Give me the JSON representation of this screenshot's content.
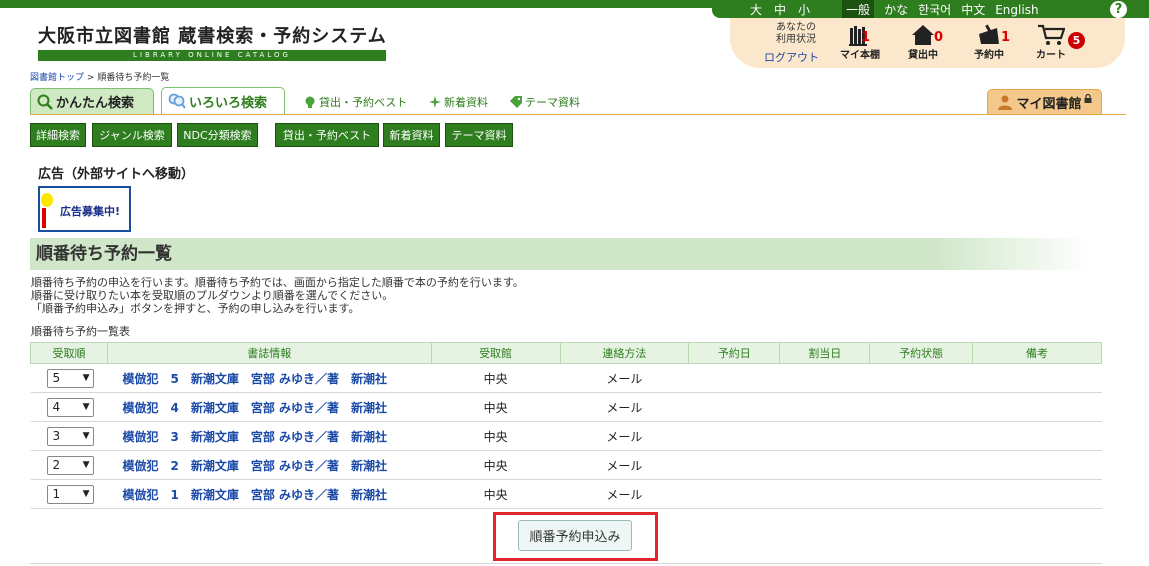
{
  "lang_bar": {
    "sizes": [
      "大",
      "中",
      "小"
    ],
    "general": "一般",
    "languages": [
      "かな",
      "한국어",
      "中文",
      "English"
    ],
    "help": "?"
  },
  "logo": {
    "title": "大阪市立図書館 蔵書検索・予約システム",
    "subtitle": "LIBRARY ONLINE CATALOG"
  },
  "user_panel": {
    "status_line1": "あなたの",
    "status_line2": "利用状況",
    "logout": "ログアウト",
    "my_shelf_label": "マイ本棚",
    "my_shelf_count": "1",
    "lending_label": "貸出中",
    "lending_count": "0",
    "reserved_label": "予約中",
    "reserved_count": "1",
    "cart_label": "カート",
    "cart_count": "5"
  },
  "breadcrumb": {
    "home": "図書館トップ",
    "sep": ">",
    "current": "順番待ち予約一覧"
  },
  "tabs": {
    "kantan": "かんたん検索",
    "iroiro": "いろいろ検索",
    "best": "貸出・予約ベスト",
    "new": "新着資料",
    "theme": "テーマ資料",
    "mylib": "マイ図書館"
  },
  "subnav": [
    "詳細検索",
    "ジャンル検索",
    "NDC分類検索",
    "貸出・予約ベスト",
    "新着資料",
    "テーマ資料"
  ],
  "ad": {
    "title": "広告（外部サイトへ移動）",
    "banner_text": "広告募集中!"
  },
  "page": {
    "title": "順番待ち予約一覧",
    "desc1": "順番待ち予約の申込を行います。順番待ち予約では、画面から指定した順番で本の予約を行います。",
    "desc2": "順番に受け取りたい本を受取順のプルダウンより順番を選んでください。",
    "desc3": "「順番予約申込み」ボタンを押すと、予約の申し込みを行います。",
    "caption": "順番待ち予約一覧表"
  },
  "table": {
    "headers": [
      "受取順",
      "書誌情報",
      "受取館",
      "連絡方法",
      "予約日",
      "割当日",
      "予約状態",
      "備考"
    ],
    "rows": [
      {
        "order": "5",
        "book": "模倣犯　5　新潮文庫　宮部 みゆき／著　新潮社",
        "branch": "中央",
        "contact": "メール"
      },
      {
        "order": "4",
        "book": "模倣犯　4　新潮文庫　宮部 みゆき／著　新潮社",
        "branch": "中央",
        "contact": "メール"
      },
      {
        "order": "3",
        "book": "模倣犯　3　新潮文庫　宮部 みゆき／著　新潮社",
        "branch": "中央",
        "contact": "メール"
      },
      {
        "order": "2",
        "book": "模倣犯　2　新潮文庫　宮部 みゆき／著　新潮社",
        "branch": "中央",
        "contact": "メール"
      },
      {
        "order": "1",
        "book": "模倣犯　1　新潮文庫　宮部 みゆき／著　新潮社",
        "branch": "中央",
        "contact": "メール"
      }
    ]
  },
  "submit_label": "順番予約申込み",
  "colors": {
    "brand_green": "#2e7d1e",
    "accent_orange": "#e6a54a",
    "highlight_red": "#e0262c",
    "link_blue": "#1a49a8"
  }
}
